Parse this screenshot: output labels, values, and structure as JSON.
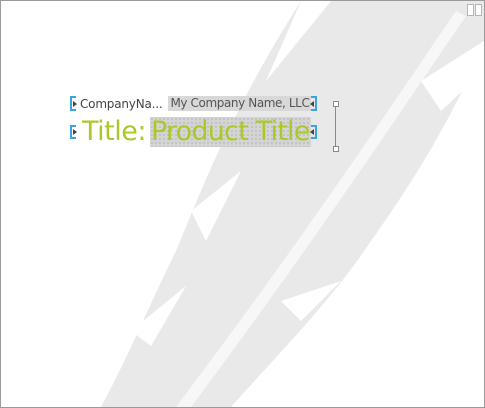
{
  "document": {
    "fields": [
      {
        "tag": "CompanyNa...",
        "value": "My Company Name, LLC"
      },
      {
        "label": "Title:",
        "value": "Product Title"
      }
    ]
  },
  "colors": {
    "accent_green": "#a9c92a",
    "bracket_blue": "#3ba3e0",
    "placeholder_gray": "#d8d8d8",
    "watermark_gray": "#e8e8e8"
  },
  "icons": {
    "watermark": "feather-icon"
  }
}
